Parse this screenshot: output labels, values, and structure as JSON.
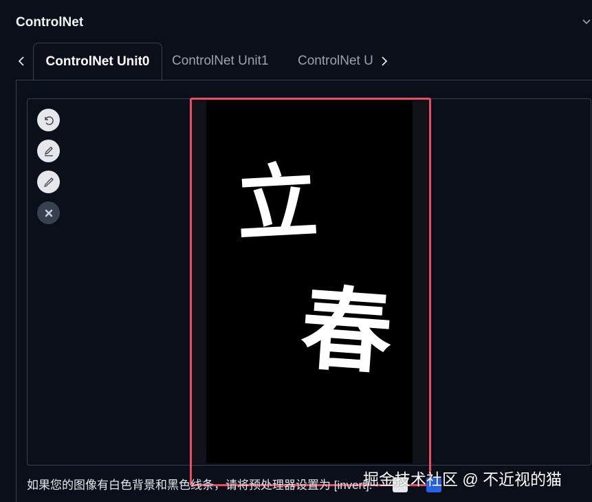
{
  "panel": {
    "title": "ControlNet"
  },
  "tabs": [
    {
      "label": "ControlNet Unit0",
      "active": true
    },
    {
      "label": "ControlNet Unit1",
      "active": false
    },
    {
      "label": "ControlNet U",
      "active": false
    }
  ],
  "toolbar": {
    "buttons": [
      {
        "icon": "undo-icon"
      },
      {
        "icon": "pencil-icon"
      },
      {
        "icon": "brush-icon"
      },
      {
        "icon": "close-icon"
      }
    ]
  },
  "canvas": {
    "chars": [
      "立",
      "春"
    ],
    "highlight_color": "#ef4b63"
  },
  "hint": {
    "text": "如果您的图像有白色背景和黑色线条，请将预处理器设置为 [invert]."
  },
  "watermark": {
    "text": "掘金技术社区 @ 不近视的猫"
  },
  "colors": {
    "background": "#0b0f19",
    "border": "#374151",
    "accent": "#ef4b63"
  }
}
